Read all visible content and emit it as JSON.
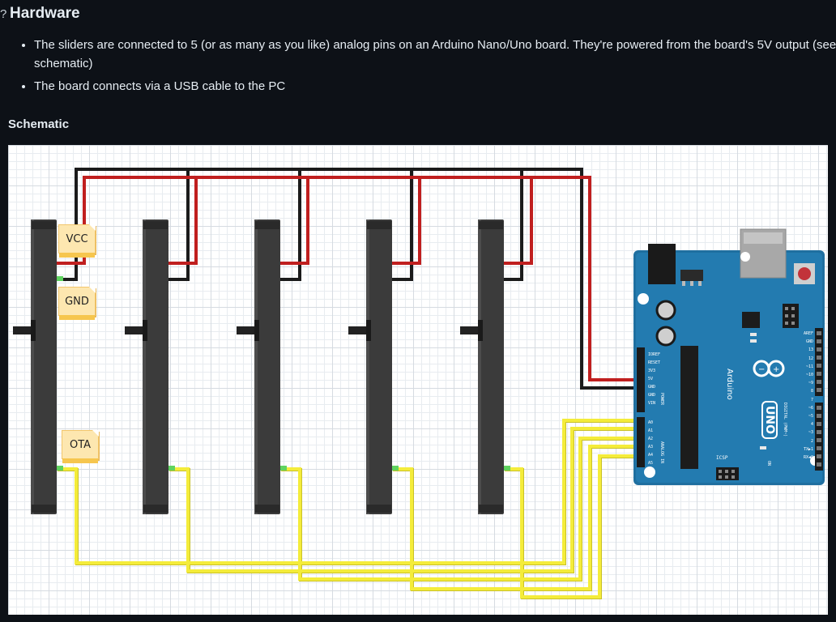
{
  "section": {
    "anchor": "?",
    "title": "Hardware"
  },
  "bullets": [
    "The sliders are connected to 5 (or as many as you like) analog pins on an Arduino Nano/Uno board. They're powered from the board's 5V output (see schematic)",
    "The board connects via a USB cable to the PC"
  ],
  "schematic": {
    "label": "Schematic",
    "notes": {
      "vcc": "VCC",
      "gnd": "GND",
      "ota": "OTA"
    },
    "board": {
      "brand": "Arduino",
      "model": "UNO",
      "icsp": "ICSP",
      "power_label": "POWER",
      "analog_label": "ANALOG IN",
      "digital_label": "DIGITAL (PWM~)",
      "on_label": "ON",
      "pins_left": [
        "IOREF",
        "RESET",
        "3V3",
        "5V",
        "GND",
        "GND",
        "VIN"
      ],
      "analog_pins": [
        "A0",
        "A1",
        "A2",
        "A3",
        "A4",
        "A5"
      ],
      "pins_right": [
        "AREF",
        "GND",
        "13",
        "12",
        "~11",
        "~10",
        "~9",
        "8",
        "7",
        "~6",
        "~5",
        "4",
        "~3",
        "2",
        "TX▶1",
        "RX◀0"
      ]
    },
    "wire_colors": {
      "vcc": "#c01f1f",
      "gnd": "#1b1b1b",
      "signal": "#f4ec3a"
    },
    "slider_count": 5
  }
}
